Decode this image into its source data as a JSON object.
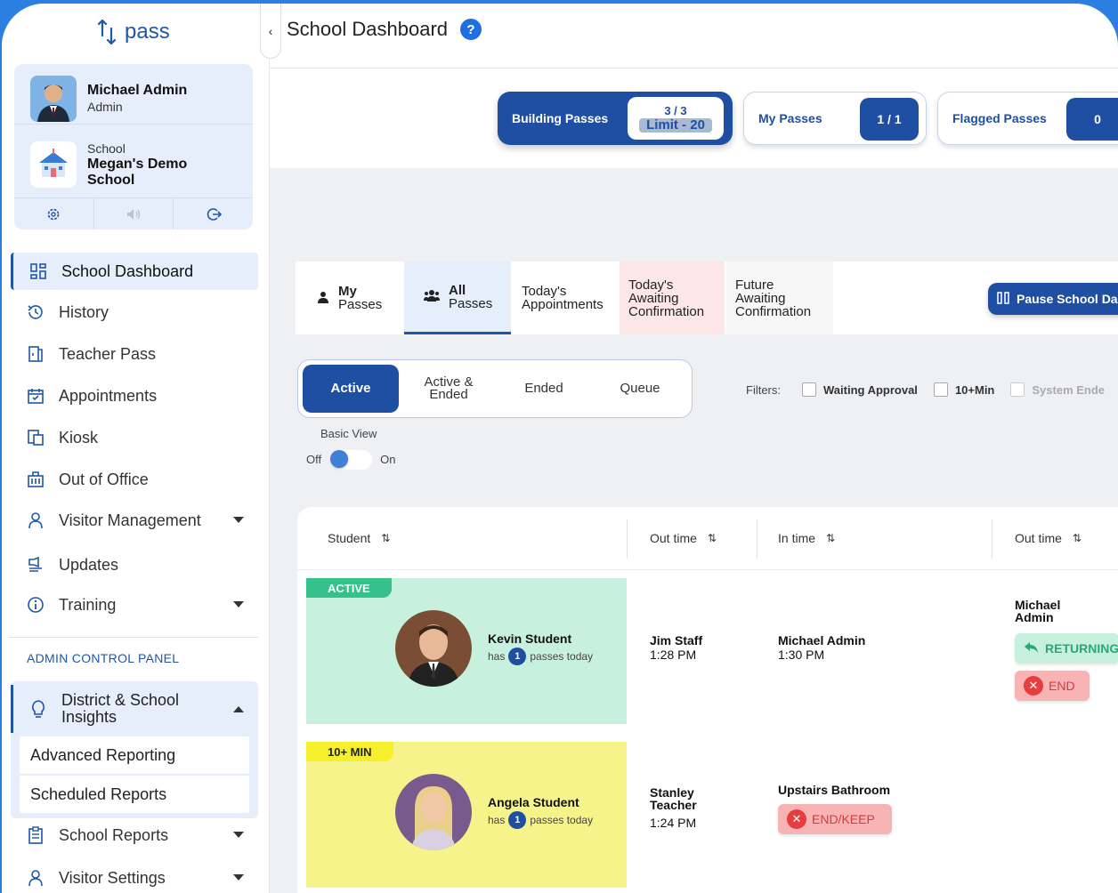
{
  "app": {
    "logo_text": "pass"
  },
  "profile": {
    "user_name": "Michael Admin",
    "user_role": "Admin",
    "school_caption": "School",
    "school_name": "Megan's Demo School"
  },
  "header": {
    "title": "School Dashboard",
    "help_icon": "?"
  },
  "sidebar": {
    "items": [
      {
        "label": "School Dashboard",
        "icon": "dashboard-icon"
      },
      {
        "label": "History",
        "icon": "history-icon"
      },
      {
        "label": "Teacher Pass",
        "icon": "teacher-pass-icon"
      },
      {
        "label": "Appointments",
        "icon": "calendar-icon"
      },
      {
        "label": "Kiosk",
        "icon": "kiosk-icon"
      },
      {
        "label": "Out of Office",
        "icon": "briefcase-icon"
      },
      {
        "label": "Visitor Management",
        "icon": "person-icon"
      },
      {
        "label": "Updates",
        "icon": "updates-icon"
      },
      {
        "label": "Training",
        "icon": "info-icon"
      }
    ],
    "admin_label": "ADMIN CONTROL PANEL",
    "insights_label": "District & School Insights",
    "insights_sub": [
      "Advanced Reporting",
      "Scheduled Reports"
    ],
    "bottom_items": [
      {
        "label": "School Reports",
        "icon": "report-icon"
      },
      {
        "label": "Visitor Settings",
        "icon": "person-icon"
      }
    ]
  },
  "counters": {
    "building": {
      "label": "Building Passes",
      "count": "3 / 3",
      "limit": "Limit - 20"
    },
    "my": {
      "label": "My Passes",
      "count": "1 / 1"
    },
    "flagged": {
      "label": "Flagged Passes",
      "count": "0"
    }
  },
  "tabs": {
    "my_passes_1": "My",
    "my_passes_2": "Passes",
    "all_passes_1": "All",
    "all_passes_2": "Passes",
    "today_appts_1": "Today's",
    "today_appts_2": "Appointments",
    "today_await_1": "Today's",
    "today_await_2": "Awaiting",
    "today_await_3": "Confirmation",
    "future_await_1": "Future",
    "future_await_2": "Awaiting",
    "future_await_3": "Confirmation",
    "pause_button": "Pause School Da"
  },
  "segment": {
    "active": "Active",
    "active_ended_1": "Active &",
    "active_ended_2": "Ended",
    "ended": "Ended",
    "queue": "Queue"
  },
  "filters": {
    "label": "Filters:",
    "waiting_approval": "Waiting Approval",
    "ten_min": "10+Min",
    "system_ended": "System Ende"
  },
  "view": {
    "basic_view": "Basic View",
    "off": "Off",
    "on": "On"
  },
  "table": {
    "headers": [
      "Student",
      "Out time",
      "In time",
      "Out time"
    ],
    "rows": [
      {
        "badge": "ACTIVE",
        "student": "Kevin Student",
        "has": "has",
        "passes_count": "1",
        "passes_today": "passes today",
        "out_name": "Jim Staff",
        "out_time": "1:28 PM",
        "in_name": "Michael Admin",
        "in_time": "1:30 PM",
        "out2_name_1": "Michael",
        "out2_name_2": "Admin",
        "returning": "RETURNING",
        "end": "END"
      },
      {
        "badge": "10+ MIN",
        "student": "Angela Student",
        "has": "has",
        "passes_count": "1",
        "passes_today": "passes today",
        "out_name_1": "Stanley",
        "out_name_2": "Teacher",
        "out_time": "1:24 PM",
        "in_name": "Upstairs Bathroom",
        "end_keep": "END/KEEP"
      }
    ]
  },
  "colors": {
    "primary": "#1f4fa3",
    "active_row": "#c8f0de",
    "warning_row": "#f6f38a",
    "danger": "#e53e3e"
  }
}
